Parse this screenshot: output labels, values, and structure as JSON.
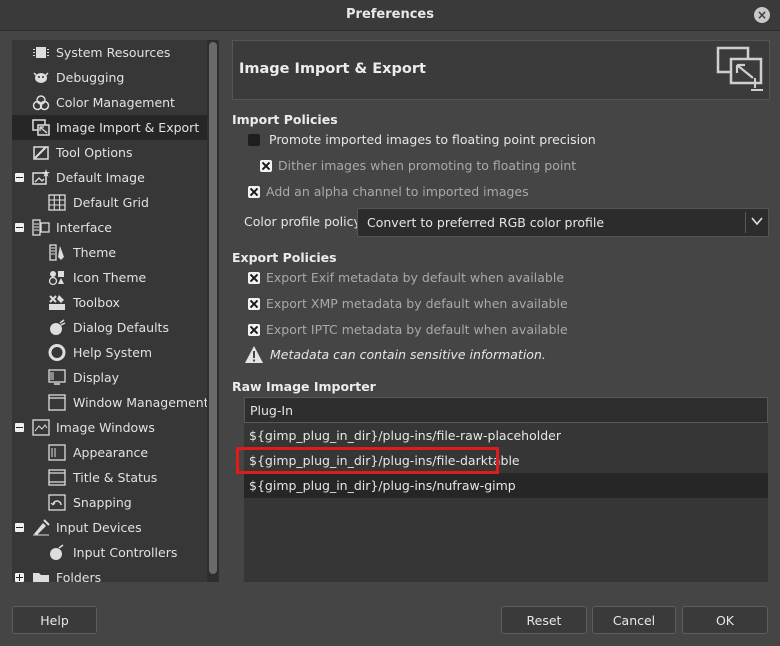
{
  "window": {
    "title": "Preferences"
  },
  "sidebar": {
    "items": [
      {
        "label": "System Resources",
        "icon": "chip-icon"
      },
      {
        "label": "Debugging",
        "icon": "bug-icon"
      },
      {
        "label": "Color Management",
        "icon": "color-circles-icon"
      },
      {
        "label": "Image Import & Export",
        "icon": "import-export-icon"
      },
      {
        "label": "Tool Options",
        "icon": "tool-options-icon"
      },
      {
        "label": "Default Image",
        "icon": "default-image-icon"
      },
      {
        "label": "Default Grid",
        "icon": "grid-icon"
      },
      {
        "label": "Interface",
        "icon": "interface-icon"
      },
      {
        "label": "Theme",
        "icon": "theme-icon"
      },
      {
        "label": "Icon Theme",
        "icon": "icon-theme-icon"
      },
      {
        "label": "Toolbox",
        "icon": "toolbox-icon"
      },
      {
        "label": "Dialog Defaults",
        "icon": "dialog-defaults-icon"
      },
      {
        "label": "Help System",
        "icon": "help-lifebuoy-icon"
      },
      {
        "label": "Display",
        "icon": "display-icon"
      },
      {
        "label": "Window Management",
        "icon": "window-management-icon"
      },
      {
        "label": "Image Windows",
        "icon": "image-windows-icon"
      },
      {
        "label": "Appearance",
        "icon": "appearance-icon"
      },
      {
        "label": "Title & Status",
        "icon": "title-status-icon"
      },
      {
        "label": "Snapping",
        "icon": "snapping-icon"
      },
      {
        "label": "Input Devices",
        "icon": "input-devices-icon"
      },
      {
        "label": "Input Controllers",
        "icon": "input-controllers-icon"
      },
      {
        "label": "Folders",
        "icon": "folders-icon"
      }
    ]
  },
  "page": {
    "title": "Image Import & Export",
    "import_policies": {
      "title": "Import Policies",
      "promote": "Promote imported images to floating point precision",
      "dither": "Dither images when promoting to floating point",
      "alpha": "Add an alpha channel to imported images",
      "color_profile_label": "Color profile policy:",
      "color_profile_value": "Convert to preferred RGB color profile"
    },
    "export_policies": {
      "title": "Export Policies",
      "exif": "Export Exif metadata by default when available",
      "xmp": "Export XMP metadata by default when available",
      "iptc": "Export IPTC metadata by default when available",
      "warning": "Metadata can contain sensitive information."
    },
    "raw_importer": {
      "title": "Raw Image Importer",
      "column_header": "Plug-In",
      "rows": [
        "${gimp_plug_in_dir}/plug-ins/file-raw-placeholder",
        "${gimp_plug_in_dir}/plug-ins/file-darktable",
        "${gimp_plug_in_dir}/plug-ins/nufraw-gimp"
      ]
    }
  },
  "buttons": {
    "help": "Help",
    "reset": "Reset",
    "cancel": "Cancel",
    "ok": "OK"
  }
}
